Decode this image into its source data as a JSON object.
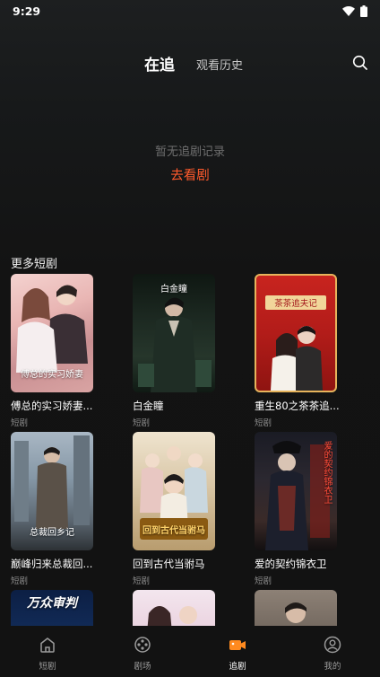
{
  "status_bar": {
    "time": "9:29"
  },
  "header": {
    "tab_following": "在追",
    "tab_history": "观看历史"
  },
  "empty_state": {
    "message": "暂无追剧记录",
    "action": "去看剧"
  },
  "more_section": {
    "title": "更多短剧",
    "items": [
      {
        "title": "傅总的实习娇妻...",
        "tag": "短剧",
        "poster_text": "傅总的实习娇妻"
      },
      {
        "title": "白金瞳",
        "tag": "短剧",
        "poster_text": "白金瞳"
      },
      {
        "title": "重生80之茶茶追...",
        "tag": "短剧",
        "poster_text": "茶茶追夫记"
      },
      {
        "title": "巅峰归来总裁回...",
        "tag": "短剧",
        "poster_text": "总裁回乡记"
      },
      {
        "title": "回到古代当驸马",
        "tag": "短剧",
        "poster_text": "回到古代当驸马"
      },
      {
        "title": "爱的契约锦衣卫",
        "tag": "短剧",
        "poster_text": "爱的契约锦衣卫"
      },
      {
        "title": "",
        "tag": "",
        "poster_text": "万众审判"
      },
      {
        "title": "",
        "tag": "",
        "poster_text": ""
      },
      {
        "title": "",
        "tag": "",
        "poster_text": ""
      }
    ]
  },
  "bottom_nav": {
    "items": [
      {
        "label": "短剧",
        "icon": "home-icon",
        "active": false
      },
      {
        "label": "剧场",
        "icon": "theater-icon",
        "active": false
      },
      {
        "label": "追剧",
        "icon": "video-icon",
        "active": true
      },
      {
        "label": "我的",
        "icon": "profile-icon",
        "active": false
      }
    ]
  },
  "colors": {
    "accent": "#ff5a2c",
    "background": "#121212",
    "muted": "#6e6e6e"
  }
}
